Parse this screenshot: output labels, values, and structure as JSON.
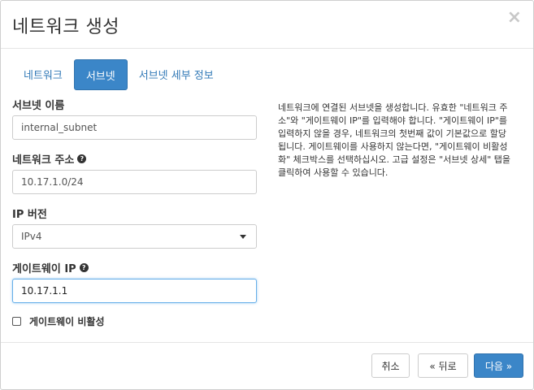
{
  "modal": {
    "title": "네트워크 생성",
    "close_glyph": "×"
  },
  "tabs": [
    {
      "label": "네트워크",
      "active": false
    },
    {
      "label": "서브넷",
      "active": true
    },
    {
      "label": "서브넷 세부 정보",
      "active": false
    }
  ],
  "form": {
    "subnet_name": {
      "label": "서브넷 이름",
      "value": "internal_subnet"
    },
    "network_address": {
      "label": "네트워크 주소",
      "value": "10.17.1.0/24",
      "help_icon": "question-circle-icon"
    },
    "ip_version": {
      "label": "IP 버전",
      "selected": "IPv4"
    },
    "gateway_ip": {
      "label": "게이트웨이 IP",
      "value": "10.17.1.1",
      "help_icon": "question-circle-icon"
    },
    "disable_gateway": {
      "label": "게이트웨이 비활성",
      "checked": false
    }
  },
  "help_text": "네트워크에 연결된 서브넷을 생성합니다. 유효한 \"네트워크 주소\"와 \"게이트웨이 IP\"를 입력해야 합니다. \"게이트웨이 IP\"를 입력하지 않을 경우, 네트워크의 첫번째 값이 기본값으로 할당됩니다. 게이트웨이를 사용하지 않는다면, \"게이트웨이 비활성화\" 체크박스를 선택하십시오. 고급 설정은 \"서브넷 상세\" 탭을 클릭하여 사용할 수 있습니다.",
  "footer": {
    "cancel_label": "취소",
    "back_label": "« 뒤로",
    "next_label": "다음 »"
  },
  "colors": {
    "accent": "#3b86c8",
    "link": "#337ab7"
  }
}
